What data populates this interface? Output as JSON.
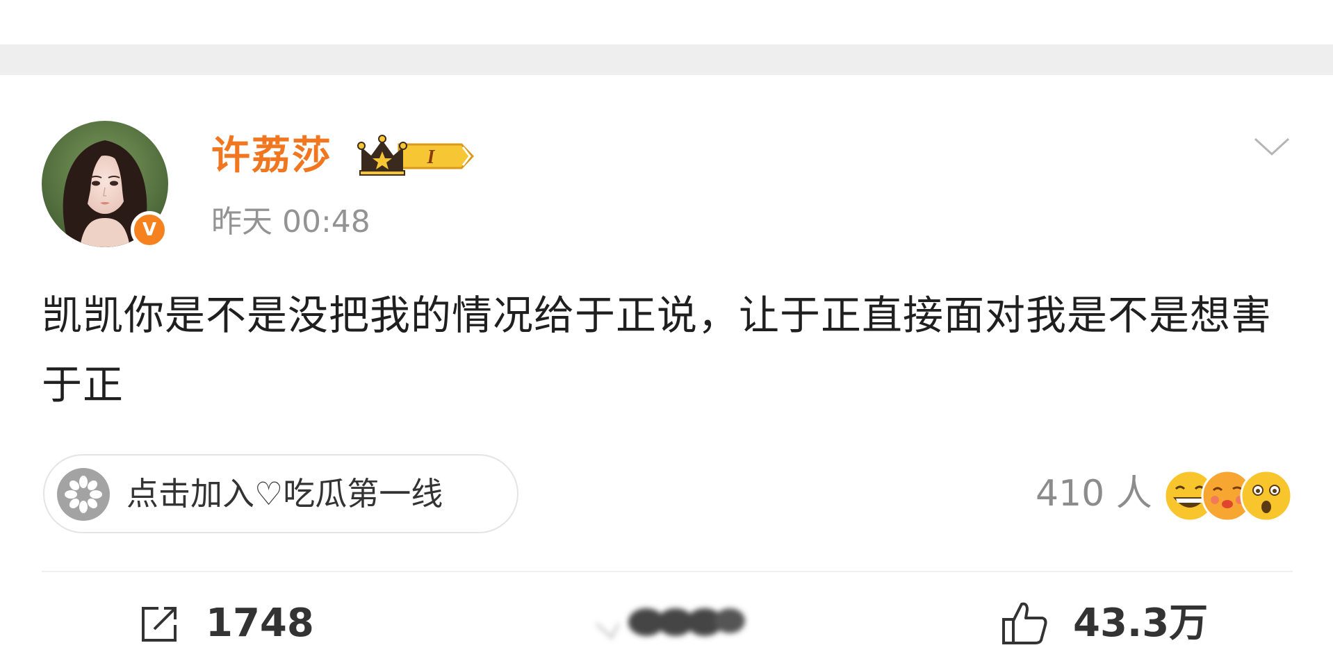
{
  "post": {
    "author": {
      "name": "许荔莎",
      "verified_icon": "orange-v-verified-icon",
      "vip_badge_icon": "crown-vip-badge",
      "vip_level": "I"
    },
    "timestamp": "昨天 00:48",
    "content": "凯凯你是不是没把我的情况给于正说，让于正直接面对我是不是想害于正",
    "topic": {
      "icon": "gray-flower-icon",
      "label": "点击加入♡吃瓜第一线"
    },
    "reactions": {
      "count_label": "410 人",
      "emoji_icons": [
        "grinning-face-icon",
        "kissing-face-icon",
        "surprised-face-icon"
      ]
    },
    "actions": {
      "repost_icon": "repost-icon",
      "repost_count": "1748",
      "comment_icon": "comment-icon-blurred",
      "like_icon": "thumbs-up-icon",
      "like_count": "43.3万"
    }
  },
  "colors": {
    "username": "#f0761f",
    "verified": "#f5821f",
    "timestamp": "#939393",
    "text": "#1f1f1f",
    "reaction_count": "#8c8c8c",
    "topbar": "#eeeeee"
  }
}
